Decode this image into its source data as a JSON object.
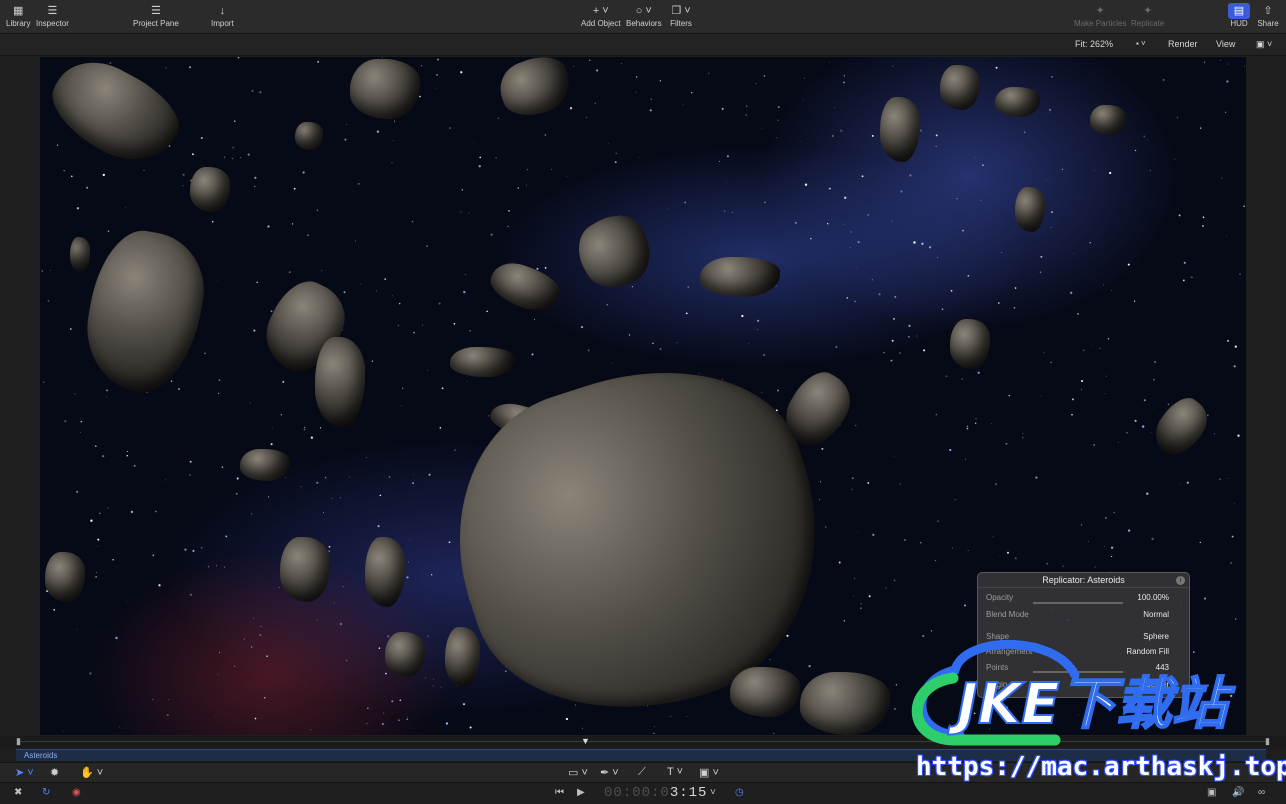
{
  "toolbar": {
    "library": "Library",
    "inspector": "Inspector",
    "project_pane": "Project Pane",
    "import": "Import",
    "add_object": "Add Object",
    "behaviors": "Behaviors",
    "filters": "Filters",
    "make_particles": "Make Particles",
    "replicate": "Replicate",
    "hud": "HUD",
    "share": "Share"
  },
  "viewer": {
    "fit": "Fit: 262%",
    "render": "Render",
    "view": "View"
  },
  "hud_panel": {
    "title": "Replicator: Asteroids",
    "rows": [
      {
        "label": "Opacity",
        "value": "100.00%"
      },
      {
        "label": "Blend Mode",
        "value": "Normal"
      },
      {
        "label": "Shape",
        "value": "Sphere"
      },
      {
        "label": "Arrangement",
        "value": "Random Fill"
      },
      {
        "label": "Points",
        "value": "443"
      },
      {
        "label": "Origin",
        "value": "Center"
      }
    ]
  },
  "timeline": {
    "layer_name": "Asteroids"
  },
  "transport": {
    "timecode_dim": "00:00:0",
    "timecode_bright": "3:15"
  },
  "watermark": {
    "logo_text": "JKE下载站",
    "url": "https://mac.arthaskj.top"
  },
  "colors": {
    "accent": "#3b5bd8",
    "tool_active": "#5a87ff",
    "watermark_green": "#2ecf6b",
    "watermark_blue": "#2f6cf0"
  }
}
